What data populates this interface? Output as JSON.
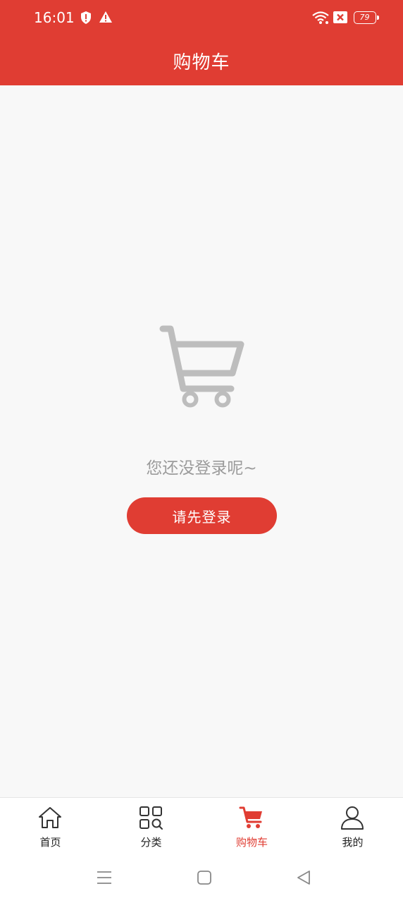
{
  "status_bar": {
    "time": "16:01",
    "battery": "79",
    "icons": [
      "shield-icon",
      "warning-icon",
      "wifi-icon",
      "sim-blocked-icon",
      "battery-icon"
    ]
  },
  "header": {
    "title": "购物车"
  },
  "empty_state": {
    "icon": "cart-icon",
    "message": "您还没登录呢~",
    "button_label": "请先登录"
  },
  "tabbar": {
    "tabs": [
      {
        "label": "首页",
        "icon": "home-icon",
        "active": false
      },
      {
        "label": "分类",
        "icon": "category-icon",
        "active": false
      },
      {
        "label": "购物车",
        "icon": "cart-icon",
        "active": true
      },
      {
        "label": "我的",
        "icon": "profile-icon",
        "active": false
      }
    ]
  },
  "system_nav": {
    "buttons": [
      "menu-icon",
      "home-square-icon",
      "back-triangle-icon"
    ]
  },
  "colors": {
    "brand": "#e03d33",
    "background": "#f8f8f8",
    "muted_text": "#9b9b9b",
    "icon_gray": "#bdbdbd"
  }
}
